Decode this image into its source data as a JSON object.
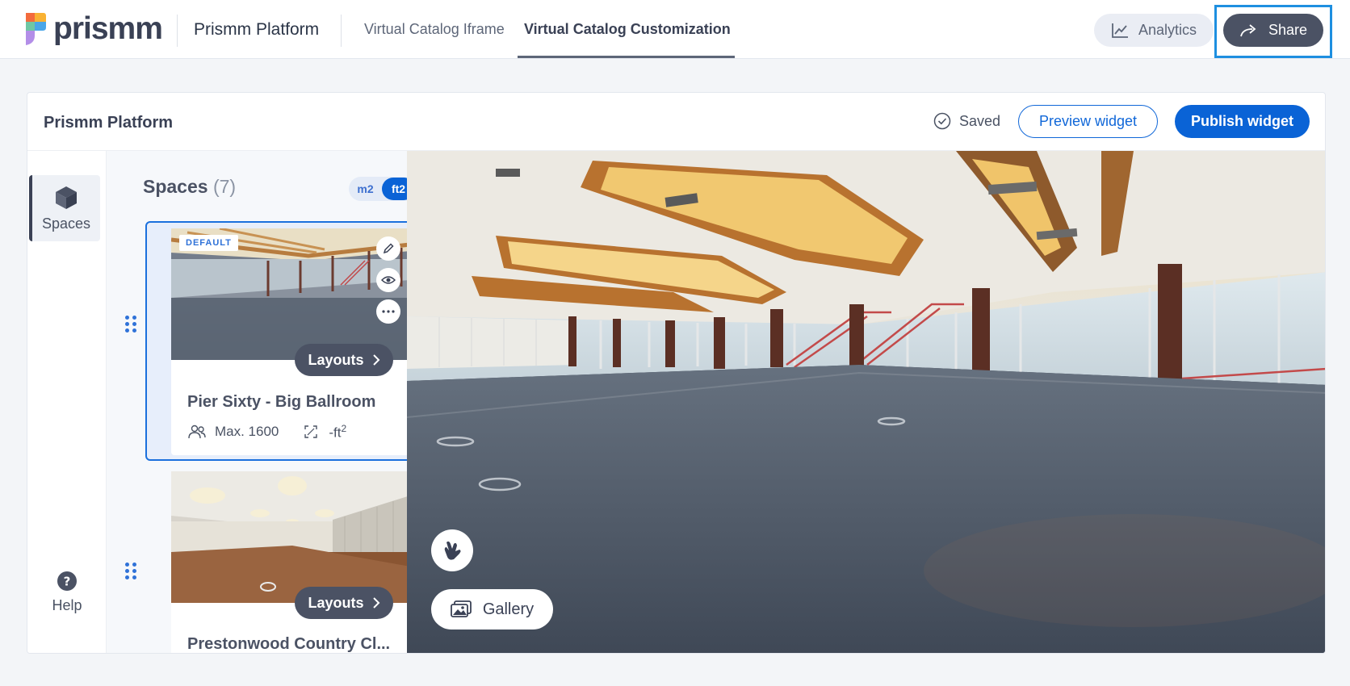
{
  "nav": {
    "logo_text": "prismm",
    "platform_title": "Prismm Platform",
    "tabs": [
      {
        "label": "Virtual Catalog Iframe",
        "active": false
      },
      {
        "label": "Virtual Catalog Customization",
        "active": true
      }
    ],
    "analytics_label": "Analytics",
    "share_label": "Share"
  },
  "widget": {
    "title": "Prismm Platform",
    "status_label": "Saved",
    "preview_label": "Preview widget",
    "publish_label": "Publish widget"
  },
  "rail": {
    "spaces_label": "Spaces",
    "help_label": "Help"
  },
  "spaces": {
    "title": "Spaces",
    "count": "(7)",
    "units": [
      {
        "label": "m2",
        "selected": false
      },
      {
        "label": "ft2",
        "selected": true
      }
    ],
    "items": [
      {
        "name": "Pier Sixty - Big Ballroom",
        "badge": "DEFAULT",
        "capacity": "Max. 1600",
        "area": "-ft",
        "area_sup": "2",
        "layouts_label": "Layouts",
        "selected": true
      },
      {
        "name": "Prestonwood Country Cl...",
        "layouts_label": "Layouts",
        "selected": false
      }
    ]
  },
  "viewer": {
    "gallery_label": "Gallery"
  },
  "colors": {
    "accent": "#0a63d6",
    "dark_button": "#4b5264",
    "share_focus_outline": "#1e8fe0"
  }
}
